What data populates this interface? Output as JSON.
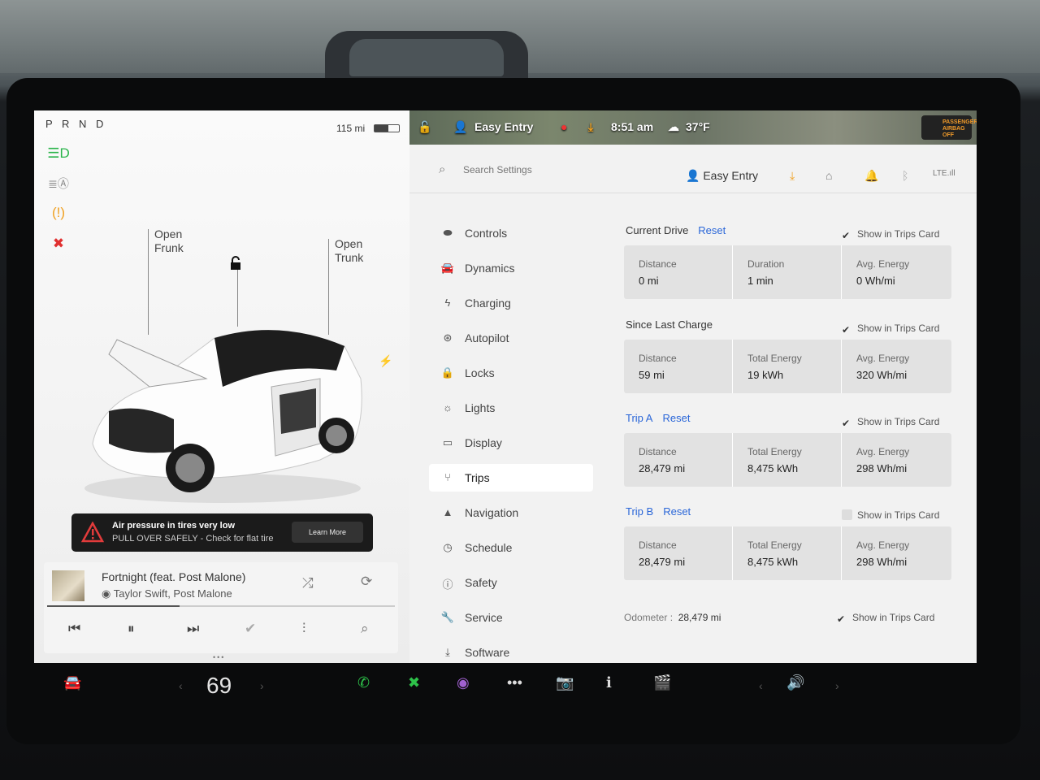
{
  "left_panel": {
    "gear": "P R N D",
    "range": "115 mi",
    "battery_level": 0.55,
    "callouts": {
      "frunk": [
        "Open",
        "Frunk"
      ],
      "trunk": [
        "Open",
        "Trunk"
      ]
    },
    "alert": {
      "title": "Air pressure in tires very low",
      "subtitle": "PULL OVER SAFELY - Check for flat tire",
      "button": "Learn More"
    },
    "media": {
      "song": "Fortnight (feat. Post Malone)",
      "artist": "Taylor Swift, Post Malone",
      "progress": 0.38
    }
  },
  "status_bar": {
    "profile": "Easy Entry",
    "time": "8:51 am",
    "temperature": "37°F",
    "airbag_line1": "PASSENGER",
    "airbag_line2": "AIRBAG OFF"
  },
  "settings": {
    "search_placeholder": "Search Settings",
    "profile": "Easy Entry",
    "nav": [
      {
        "label": "Controls",
        "icon": "toggle-icon"
      },
      {
        "label": "Dynamics",
        "icon": "car-icon"
      },
      {
        "label": "Charging",
        "icon": "bolt-icon"
      },
      {
        "label": "Autopilot",
        "icon": "steering-wheel-icon"
      },
      {
        "label": "Locks",
        "icon": "lock-icon"
      },
      {
        "label": "Lights",
        "icon": "sun-icon"
      },
      {
        "label": "Display",
        "icon": "display-icon"
      },
      {
        "label": "Trips",
        "icon": "trips-icon"
      },
      {
        "label": "Navigation",
        "icon": "navigation-icon"
      },
      {
        "label": "Schedule",
        "icon": "clock-icon"
      },
      {
        "label": "Safety",
        "icon": "info-icon"
      },
      {
        "label": "Service",
        "icon": "wrench-icon"
      },
      {
        "label": "Software",
        "icon": "download-icon"
      }
    ],
    "active": "Trips",
    "show_label": "Show in Trips Card",
    "reset_label": "Reset",
    "sections": [
      {
        "title": "Current Drive",
        "reset": true,
        "title_blue": false,
        "checked": true,
        "cells": [
          {
            "k": "Distance",
            "v": "0 mi"
          },
          {
            "k": "Duration",
            "v": "1 min"
          },
          {
            "k": "Avg. Energy",
            "v": "0 Wh/mi"
          }
        ]
      },
      {
        "title": "Since Last Charge",
        "reset": false,
        "title_blue": false,
        "checked": true,
        "cells": [
          {
            "k": "Distance",
            "v": "59 mi"
          },
          {
            "k": "Total Energy",
            "v": "19 kWh"
          },
          {
            "k": "Avg. Energy",
            "v": "320 Wh/mi"
          }
        ]
      },
      {
        "title": "Trip A",
        "reset": true,
        "title_blue": true,
        "checked": true,
        "cells": [
          {
            "k": "Distance",
            "v": "28,479 mi"
          },
          {
            "k": "Total Energy",
            "v": "8,475 kWh"
          },
          {
            "k": "Avg. Energy",
            "v": "298 Wh/mi"
          }
        ]
      },
      {
        "title": "Trip B",
        "reset": true,
        "title_blue": true,
        "checked": false,
        "cells": [
          {
            "k": "Distance",
            "v": "28,479 mi"
          },
          {
            "k": "Total Energy",
            "v": "8,475 kWh"
          },
          {
            "k": "Avg. Energy",
            "v": "298 Wh/mi"
          }
        ]
      }
    ],
    "odometer_label": "Odometer :",
    "odometer_value": "28,479 mi"
  },
  "bottom_bar": {
    "temperature": "69"
  }
}
